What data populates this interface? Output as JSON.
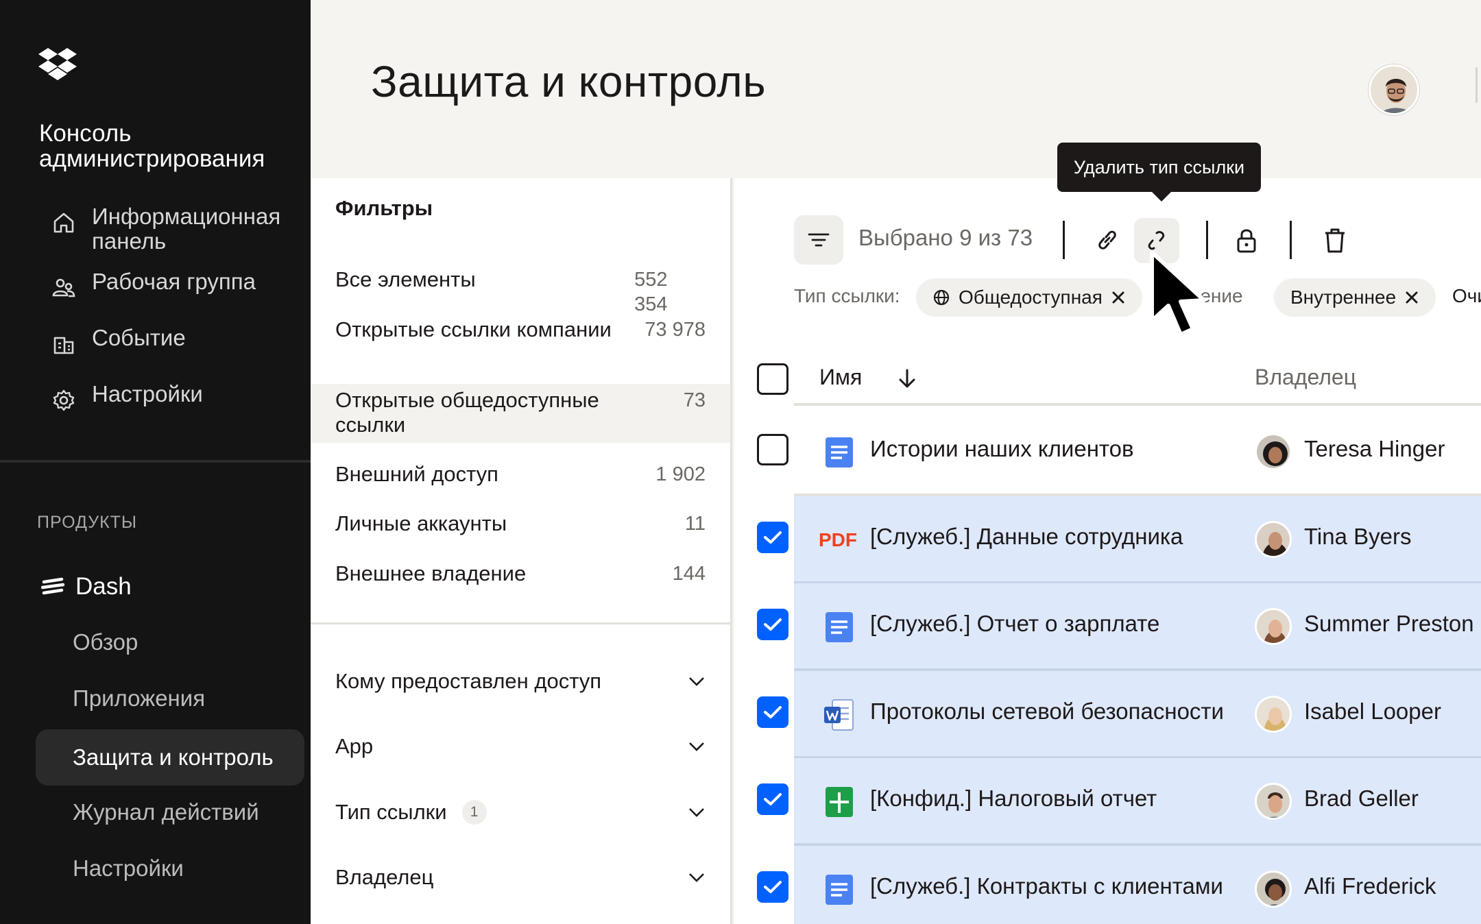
{
  "sidebar": {
    "console_title": "Консоль администрирования",
    "nav": [
      {
        "label": "Информационная панель",
        "icon": "home-icon"
      },
      {
        "label": "Рабочая группа",
        "icon": "people-icon"
      },
      {
        "label": "Событие",
        "icon": "building-icon"
      },
      {
        "label": "Настройки",
        "icon": "gear-icon"
      }
    ],
    "products_label": "ПРОДУКТЫ",
    "product": {
      "label": "Dash",
      "icon": "dash-icon"
    },
    "sub_items": [
      {
        "label": "Обзор"
      },
      {
        "label": "Приложения"
      },
      {
        "label": "Защита и контроль",
        "active": true
      },
      {
        "label": "Журнал действий"
      },
      {
        "label": "Настройки"
      }
    ]
  },
  "header": {
    "title": "Защита и контроль"
  },
  "filters": {
    "title": "Фильтры",
    "items": [
      {
        "label": "Все элементы",
        "count": "552 354"
      },
      {
        "label": "Открытые ссылки компании",
        "count": "73 978"
      },
      {
        "label": "Открытые общедоступные ссылки",
        "count": "73",
        "selected": true
      },
      {
        "label": "Внешний доступ",
        "count": "1 902"
      },
      {
        "label": "Личные аккаунты",
        "count": "11"
      },
      {
        "label": "Внешнее владение",
        "count": "144"
      }
    ],
    "accordions": [
      {
        "label": "Кому предоставлен доступ",
        "badge": ""
      },
      {
        "label": "App",
        "badge": ""
      },
      {
        "label": "Тип ссылки",
        "badge": "1"
      },
      {
        "label": "Владелец",
        "badge": ""
      }
    ]
  },
  "toolbar": {
    "selected_text": "Выбрано 9 из 73",
    "tooltip": "Удалить тип ссылки",
    "chip_label": "Тип ссылки:",
    "chips": [
      {
        "label": "Общедоступная",
        "icon": "globe-icon"
      },
      {
        "label": "Внутреннее"
      }
    ],
    "partial_chip_text": "ление",
    "edge_text": "Очи"
  },
  "table": {
    "col_name": "Имя",
    "col_owner": "Владелец",
    "rows": [
      {
        "name": "Истории наших клиентов",
        "owner": "Teresa Hinger",
        "type": "doc",
        "checked": false
      },
      {
        "name": "[Служеб.] Данные сотрудника",
        "owner": "Tina Byers",
        "type": "pdf",
        "checked": true
      },
      {
        "name": "[Служеб.] Отчет о зарплате",
        "owner": "Summer Preston",
        "type": "doc",
        "checked": true
      },
      {
        "name": "Протоколы сетевой безопасности",
        "owner": "Isabel Looper",
        "type": "word",
        "checked": true
      },
      {
        "name": "[Конфид.] Налоговый отчет",
        "owner": "Brad Geller",
        "type": "sheet",
        "checked": true
      },
      {
        "name": "[Служеб.] Контракты с клиентами",
        "owner": "Alfi Frederick",
        "type": "doc",
        "checked": true
      }
    ],
    "pdf_label": "PDF"
  },
  "colors": {
    "accent": "#0061fe",
    "selected_row": "#dde8fb",
    "sidebar_bg": "#141414",
    "pdf_red": "#f0401e",
    "sheet_green": "#1e9e49",
    "doc_blue": "#4b82f1"
  }
}
